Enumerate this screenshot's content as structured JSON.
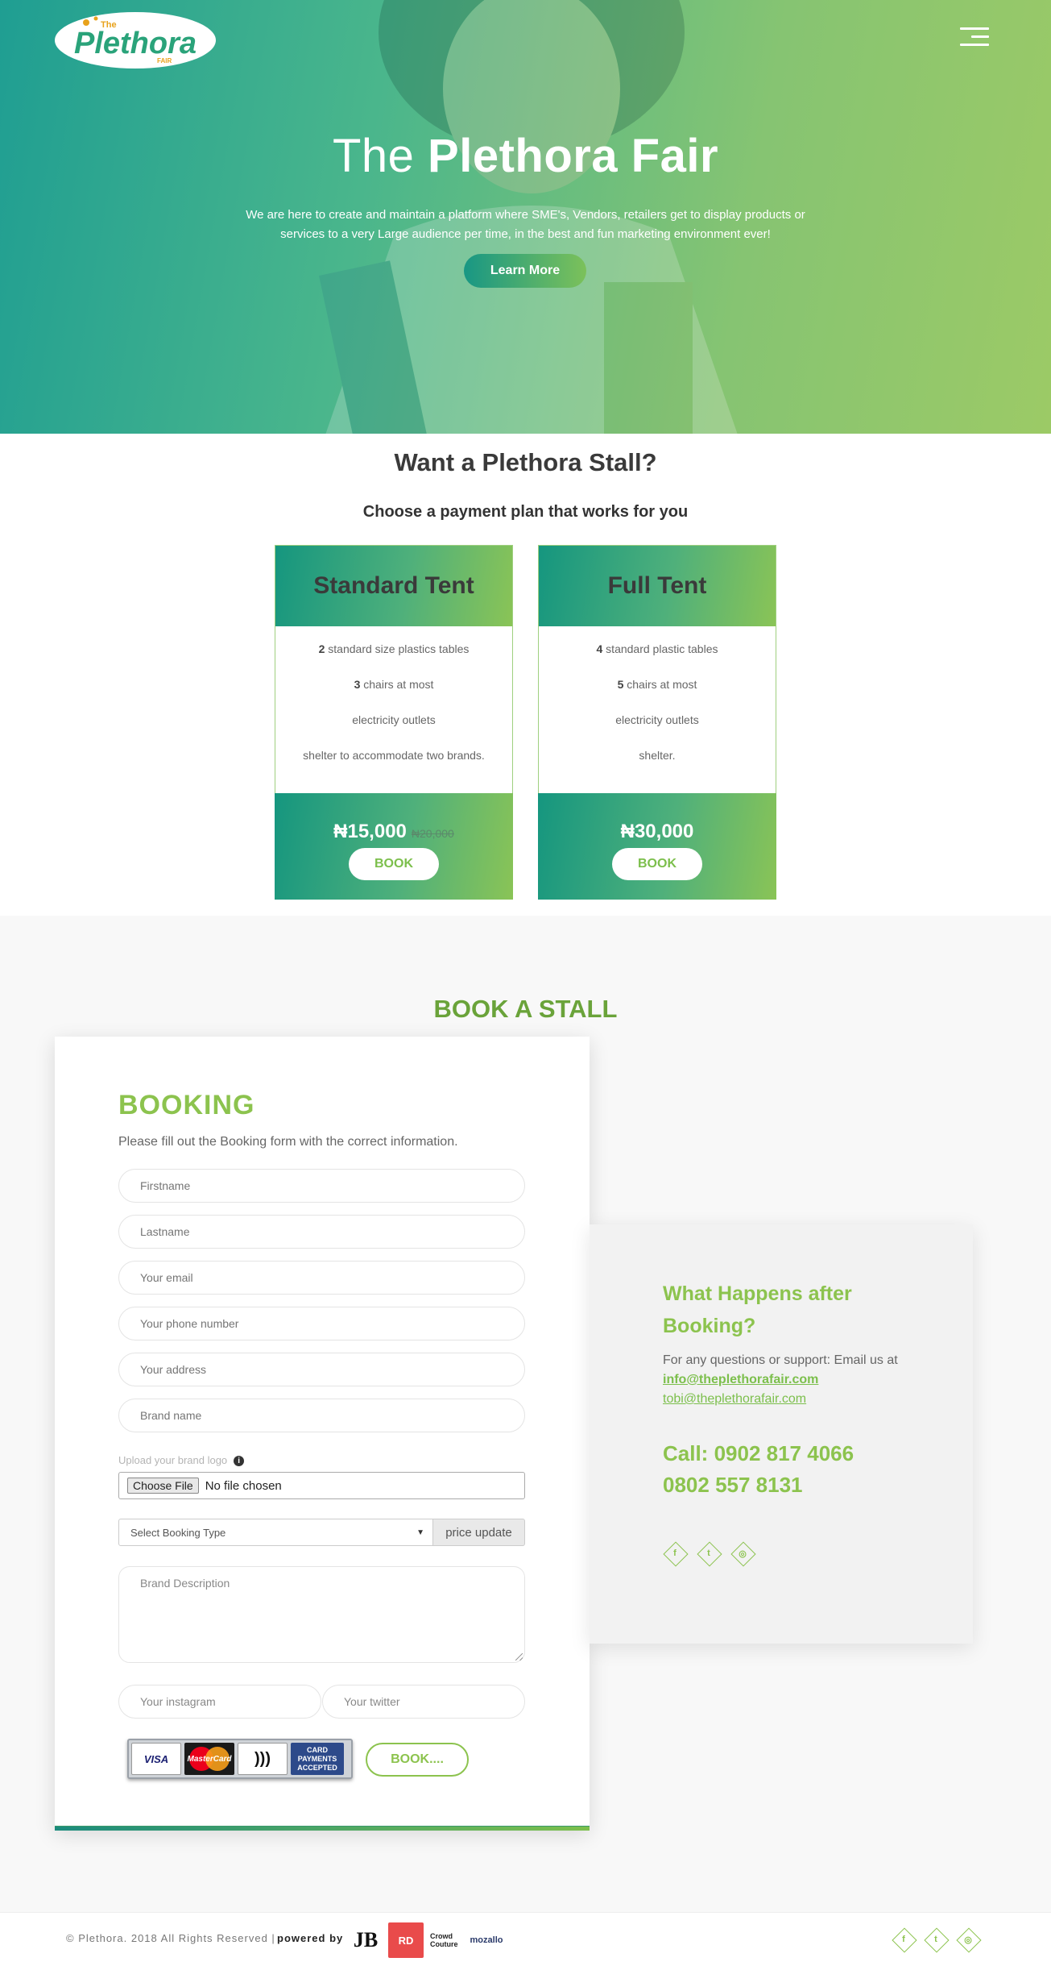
{
  "hero": {
    "logo_text": "Plethora",
    "logo_small_top": "The",
    "logo_small_bottom": "FAIR",
    "title_light": "The",
    "title_bold": "Plethora Fair",
    "description": "We are here to create and maintain a platform where SME's, Vendors, retailers get to display products or services to a very Large audience per time, in the best and fun marketing environment ever!",
    "cta_label": "Learn More"
  },
  "stall": {
    "title": "Want a Plethora Stall?",
    "subtitle": "Choose a payment plan that works for you",
    "plans": [
      {
        "name": "Standard Tent",
        "features": [
          {
            "bold": "2",
            "text": " standard size plastics tables"
          },
          {
            "bold": "3",
            "text": " chairs at most"
          },
          {
            "bold": "",
            "text": "electricity outlets"
          },
          {
            "bold": "",
            "text": "shelter to accommodate two brands."
          }
        ],
        "price": "₦15,000",
        "old_price": "₦20,000",
        "button": "BOOK"
      },
      {
        "name": "Full Tent",
        "features": [
          {
            "bold": "4",
            "text": " standard plastic tables"
          },
          {
            "bold": "5",
            "text": " chairs at most"
          },
          {
            "bold": "",
            "text": "electricity outlets"
          },
          {
            "bold": "",
            "text": "shelter."
          }
        ],
        "price": "₦30,000",
        "old_price": "",
        "button": "BOOK"
      }
    ]
  },
  "booking": {
    "section_title": "BOOK A STALL",
    "heading": "BOOKING",
    "intro": "Please fill out the Booking form with the correct information.",
    "fields": {
      "firstname": "Firstname",
      "lastname": "Lastname",
      "email": "Your email",
      "phone": "Your phone number",
      "address": "Your address",
      "brand": "Brand name"
    },
    "upload_label": "Upload your brand logo",
    "file_button": "Choose File",
    "file_status": "No file chosen",
    "select_placeholder": "Select Booking Type",
    "price_update": "price update",
    "description_placeholder": "Brand Description",
    "instagram_placeholder": "Your instagram",
    "twitter_placeholder": "Your twitter",
    "cards": {
      "visa": "VISA",
      "mastercard": "MasterCard",
      "accepted": "CARD PAYMENTS ACCEPTED"
    },
    "submit_label": "BOOK...."
  },
  "after_booking": {
    "title": "What Happens after Booking?",
    "support_text": "For any questions or support: Email us at",
    "email_primary": "info@theplethorafair.com",
    "email_secondary": "tobi@theplethorafair.com",
    "call_line1": "Call: 0902 817 4066",
    "call_line2": "0802 557 8131",
    "socials": [
      {
        "icon": "facebook-icon",
        "glyph": "f"
      },
      {
        "icon": "twitter-icon",
        "glyph": "t"
      },
      {
        "icon": "instagram-icon",
        "glyph": "◎"
      }
    ]
  },
  "footer": {
    "copyright": "© Plethora. 2018 All Rights Reserved |",
    "powered": "powered by",
    "sponsors": [
      "JB",
      "RD",
      "Crowd Couture",
      "mozallo"
    ]
  },
  "colors": {
    "accent_green": "#8cc34e",
    "teal": "#15967f",
    "heading_dark": "#3a3a3a"
  }
}
